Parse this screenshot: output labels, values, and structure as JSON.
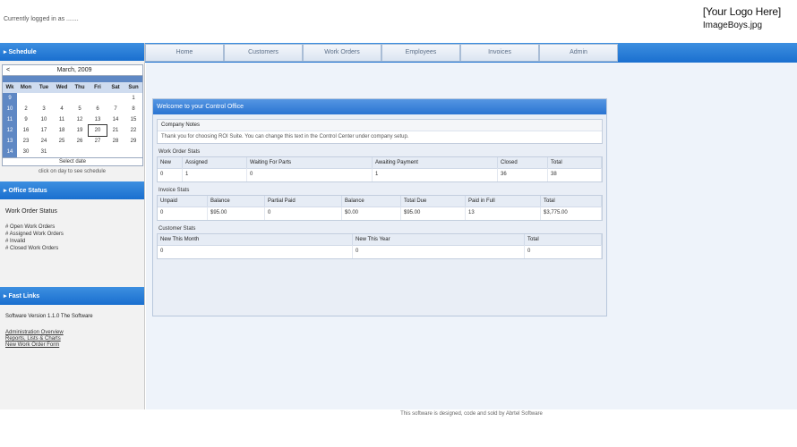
{
  "header": {
    "login_text": "Currently logged in as .......",
    "logo_line1": "[Your Logo Here]",
    "logo_line2": "ImageBoys.jpg"
  },
  "sidebar": {
    "schedule_title": "Schedule",
    "calendar": {
      "prev": "<",
      "month": "March, 2009",
      "day_headers": [
        "Wk",
        "Mon",
        "Tue",
        "Wed",
        "Thu",
        "Fri",
        "Sat",
        "Sun"
      ],
      "rows": [
        [
          "9",
          "",
          "",
          "",
          "",
          "",
          "",
          "1"
        ],
        [
          "10",
          "2",
          "3",
          "4",
          "5",
          "6",
          "7",
          "8"
        ],
        [
          "11",
          "9",
          "10",
          "11",
          "12",
          "13",
          "14",
          "15"
        ],
        [
          "12",
          "16",
          "17",
          "18",
          "19",
          "20",
          "21",
          "22"
        ],
        [
          "13",
          "23",
          "24",
          "25",
          "26",
          "27",
          "28",
          "29"
        ],
        [
          "14",
          "30",
          "31",
          "",
          "",
          "",
          "",
          ""
        ]
      ],
      "today_label": "Select date",
      "link": "click on day to see schedule"
    },
    "office_title": "Office Status",
    "office": {
      "heading": "Work Order Status",
      "items": [
        "# Open Work Orders",
        "# Assigned Work Orders",
        "# Invalid",
        "# Closed Work Orders"
      ]
    },
    "fast_title": "Fast Links",
    "fast": {
      "software": "Software Version 1.1.0 The Software",
      "links": [
        "Administration Overview",
        "Reports, Lists & Charts",
        "New Work Order Form"
      ]
    }
  },
  "tabs": [
    "Home",
    "Customers",
    "Work Orders",
    "Employees",
    "Invoices",
    "Admin"
  ],
  "panel": {
    "title": "Welcome to your Control Office",
    "notes_title": "Company Notes",
    "notes_body": "Thank you for choosing ROI Suite. You can change this text in the Control Center under company setup.",
    "work_orders": {
      "label": "Work Order Stats",
      "headers": [
        "New",
        "Assigned",
        "Waiting For Parts",
        "Awaiting Payment",
        "Closed",
        "Total"
      ],
      "values": [
        "0",
        "1",
        "0",
        "1",
        "36",
        "38"
      ]
    },
    "invoices": {
      "label": "Invoice Stats",
      "headers": [
        "Unpaid",
        "Balance",
        "Partial Paid",
        "Balance",
        "Total Due",
        "Paid in Full",
        "Total"
      ],
      "values": [
        "0",
        "$95.00",
        "0",
        "$0.00",
        "$95.00",
        "13",
        "$3,775.00"
      ]
    },
    "customers": {
      "label": "Customer Stats",
      "headers": [
        "New This Month",
        "New This Year",
        "Total"
      ],
      "values": [
        "0",
        "0",
        "0"
      ]
    }
  },
  "footer": "This software is designed, code and sold by Abrtel Software"
}
